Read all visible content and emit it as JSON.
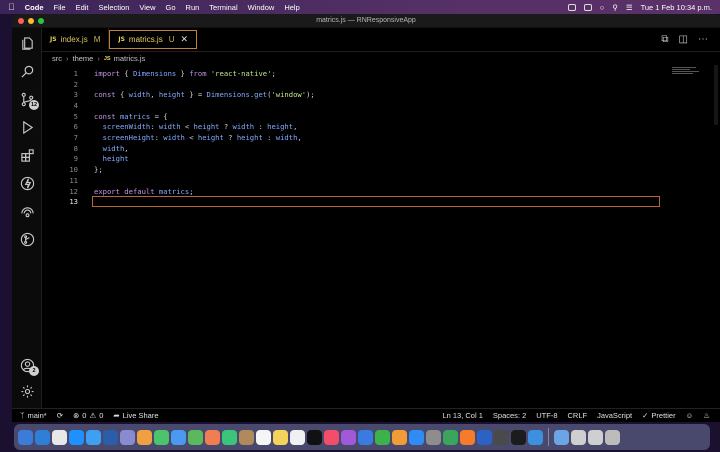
{
  "menubar": {
    "app_name": "Code",
    "items": [
      "File",
      "Edit",
      "Selection",
      "View",
      "Go",
      "Run",
      "Terminal",
      "Window",
      "Help"
    ],
    "datetime": "Tue 1 Feb  10:34 p.m."
  },
  "window": {
    "title": "matrics.js — RNResponsiveApp"
  },
  "tabs": [
    {
      "label": "index.js",
      "state": "M",
      "active": false
    },
    {
      "label": "matrics.js",
      "state": "U",
      "active": true
    }
  ],
  "breadcrumb": {
    "parts": [
      "src",
      "theme",
      "matrics.js"
    ]
  },
  "activity_bar": {
    "source_control_badge": "12",
    "accounts_badge": "2"
  },
  "editor": {
    "current_line": 13,
    "lines": [
      {
        "n": "1",
        "tokens": [
          [
            "k",
            "import"
          ],
          [
            "p",
            " { "
          ],
          [
            "v",
            "Dimensions"
          ],
          [
            "p",
            " } "
          ],
          [
            "k",
            "from"
          ],
          [
            "p",
            " "
          ],
          [
            "s",
            "'react-native'"
          ],
          [
            "p",
            ";"
          ]
        ]
      },
      {
        "n": "2",
        "tokens": []
      },
      {
        "n": "3",
        "tokens": [
          [
            "k",
            "const"
          ],
          [
            "p",
            " { "
          ],
          [
            "v",
            "width"
          ],
          [
            "p",
            ", "
          ],
          [
            "v",
            "height"
          ],
          [
            "p",
            " } = "
          ],
          [
            "v",
            "Dimensions"
          ],
          [
            "p",
            "."
          ],
          [
            "f",
            "get"
          ],
          [
            "p",
            "("
          ],
          [
            "s",
            "'window'"
          ],
          [
            "p",
            ");"
          ]
        ]
      },
      {
        "n": "4",
        "tokens": []
      },
      {
        "n": "5",
        "tokens": [
          [
            "k",
            "const"
          ],
          [
            "p",
            " "
          ],
          [
            "v",
            "matrics"
          ],
          [
            "p",
            " = {"
          ]
        ]
      },
      {
        "n": "6",
        "tokens": [
          [
            "p",
            "  "
          ],
          [
            "v",
            "screenWidth"
          ],
          [
            "p",
            ": "
          ],
          [
            "v",
            "width"
          ],
          [
            "p",
            " < "
          ],
          [
            "v",
            "height"
          ],
          [
            "p",
            " ? "
          ],
          [
            "v",
            "width"
          ],
          [
            "p",
            " : "
          ],
          [
            "v",
            "height"
          ],
          [
            "p",
            ","
          ]
        ]
      },
      {
        "n": "7",
        "tokens": [
          [
            "p",
            "  "
          ],
          [
            "v",
            "screenHeight"
          ],
          [
            "p",
            ": "
          ],
          [
            "v",
            "width"
          ],
          [
            "p",
            " < "
          ],
          [
            "v",
            "height"
          ],
          [
            "p",
            " ? "
          ],
          [
            "v",
            "height"
          ],
          [
            "p",
            " : "
          ],
          [
            "v",
            "width"
          ],
          [
            "p",
            ","
          ]
        ]
      },
      {
        "n": "8",
        "tokens": [
          [
            "p",
            "  "
          ],
          [
            "v",
            "width"
          ],
          [
            "p",
            ","
          ]
        ]
      },
      {
        "n": "9",
        "tokens": [
          [
            "p",
            "  "
          ],
          [
            "v",
            "height"
          ]
        ]
      },
      {
        "n": "10",
        "tokens": [
          [
            "p",
            "};"
          ]
        ]
      },
      {
        "n": "11",
        "tokens": []
      },
      {
        "n": "12",
        "tokens": [
          [
            "k",
            "export"
          ],
          [
            "p",
            " "
          ],
          [
            "k",
            "default"
          ],
          [
            "p",
            " "
          ],
          [
            "v",
            "matrics"
          ],
          [
            "p",
            ";"
          ]
        ]
      },
      {
        "n": "13",
        "tokens": []
      }
    ]
  },
  "statusbar": {
    "branch": "main*",
    "problems": "0",
    "warnings": "0",
    "live_share": "Live Share",
    "position": "Ln 13, Col 1",
    "spaces": "Spaces: 2",
    "encoding": "UTF-8",
    "eol": "CRLF",
    "language": "JavaScript",
    "formatter": "Prettier"
  },
  "colors": {
    "keyword": "#c792ea",
    "variable": "#82aaff",
    "string": "#c3e88d",
    "tab_active_border": "#c7803a",
    "current_line_border": "#b9652e"
  },
  "dock": {
    "icons": [
      "finder-icon",
      "vscode-icon",
      "chrome-icon",
      "skype-icon",
      "safari-icon",
      "pen-icon",
      "launchpad-icon",
      "photos-icon",
      "messages-icon",
      "mail-icon",
      "maps-icon",
      "photos-app-icon",
      "facetime-icon",
      "contacts-icon",
      "calendar-icon",
      "notes-icon",
      "reminders-icon",
      "tv-icon",
      "music-icon",
      "podcasts-icon",
      "keynote-icon",
      "numbers-icon",
      "pages-icon",
      "appstore-icon",
      "settings-icon",
      "android-studio-icon",
      "sublime-icon",
      "word-icon",
      "network-icon",
      "terminal-icon",
      "simulator-icon",
      "folder-icon",
      "window-icon",
      "window2-icon",
      "trash-icon"
    ]
  }
}
